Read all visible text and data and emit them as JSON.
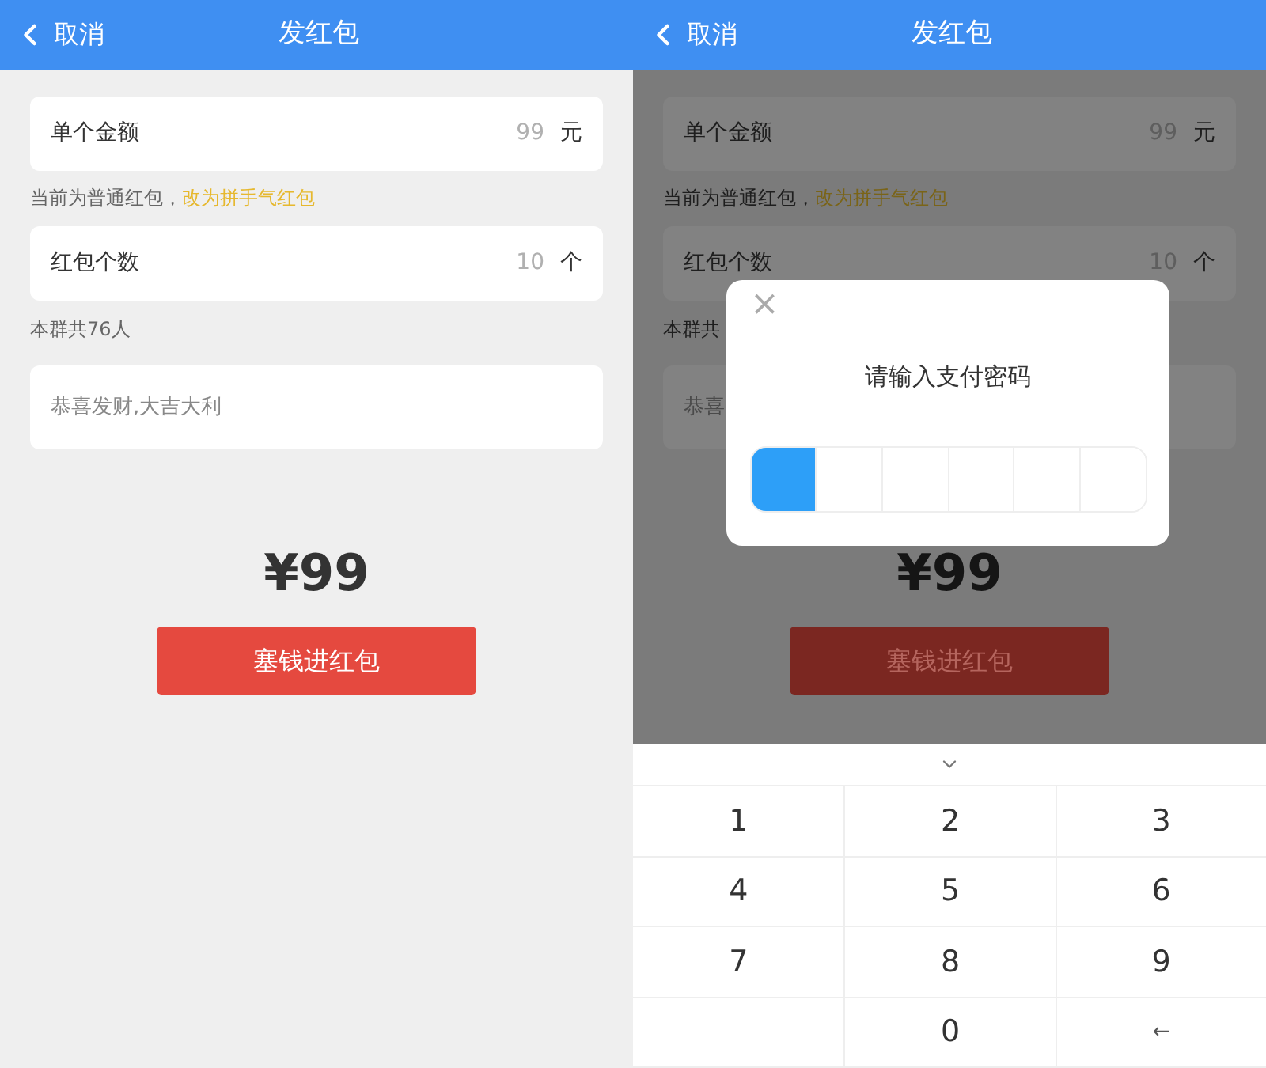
{
  "screens": [
    {
      "header": {
        "back": "取消",
        "title": "发红包"
      },
      "dimmed": false,
      "amount": {
        "label": "单个金额",
        "placeholder": "99",
        "unit": "元"
      },
      "note": {
        "text": "当前为普通红包，",
        "link": "改为拼手气红包"
      },
      "count": {
        "label": "红包个数",
        "placeholder": "10",
        "unit": "个"
      },
      "members": "本群共76人",
      "greeting": {
        "placeholder": "恭喜发财,大吉大利"
      },
      "total": "¥99",
      "submit": "塞钱进红包"
    },
    {
      "header": {
        "back": "取消",
        "title": "发红包"
      },
      "dimmed": true,
      "amount": {
        "label": "单个金额",
        "placeholder": "99",
        "unit": "元"
      },
      "note": {
        "text": "当前为普通红包，",
        "link": "改为拼手气红包"
      },
      "count": {
        "label": "红包个数",
        "placeholder": "10",
        "unit": "个"
      },
      "members": "本群共",
      "greeting": {
        "placeholder": "恭喜"
      },
      "total": "¥99",
      "submit": "塞钱进红包",
      "dialog": {
        "close": "×",
        "title": "请输入支付密码",
        "pin": [
          {
            "filled": true
          },
          {
            "filled": false
          },
          {
            "filled": false
          },
          {
            "filled": false
          },
          {
            "filled": false
          },
          {
            "filled": false
          }
        ]
      },
      "keypad": {
        "keys": [
          {
            "kind": "digit",
            "label": "1"
          },
          {
            "kind": "digit",
            "label": "2"
          },
          {
            "kind": "digit",
            "label": "3"
          },
          {
            "kind": "digit",
            "label": "4"
          },
          {
            "kind": "digit",
            "label": "5"
          },
          {
            "kind": "digit",
            "label": "6"
          },
          {
            "kind": "digit",
            "label": "7"
          },
          {
            "kind": "digit",
            "label": "8"
          },
          {
            "kind": "digit",
            "label": "9"
          },
          {
            "kind": "blank"
          },
          {
            "kind": "digit",
            "label": "0"
          },
          {
            "kind": "backspace",
            "label": "←"
          }
        ]
      }
    }
  ]
}
